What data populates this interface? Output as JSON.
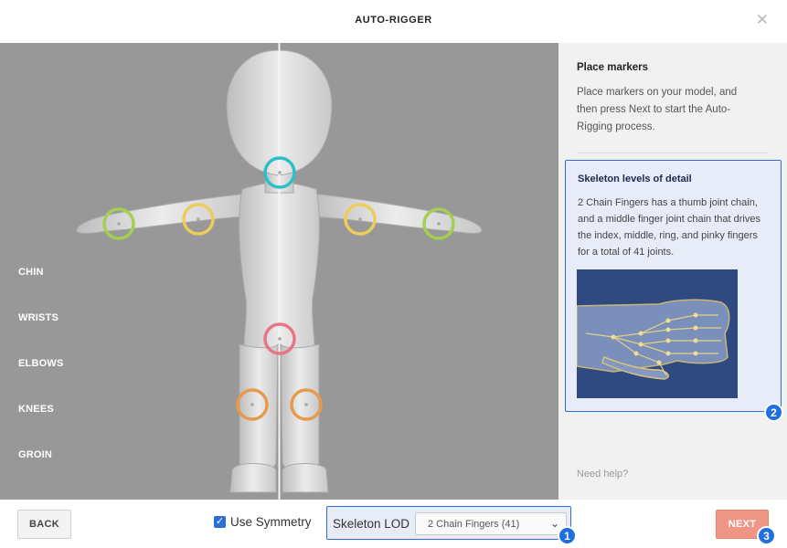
{
  "header": {
    "title": "AUTO-RIGGER",
    "close_glyph": "✕"
  },
  "viewport": {
    "marker_labels": [
      "CHIN",
      "WRISTS",
      "ELBOWS",
      "KNEES",
      "GROIN"
    ],
    "marker_colors": {
      "chin": "#2ac0c8",
      "wrists": "#a4cf52",
      "elbows": "#e9cf5a",
      "knees": "#e89a4c",
      "groin": "#e97485"
    }
  },
  "panel": {
    "heading": "Place markers",
    "description": "Place markers on your model, and then press Next to start the Auto-Rigging process.",
    "lod_card": {
      "heading": "Skeleton levels of detail",
      "description": "2 Chain Fingers has a thumb joint chain, and a middle finger joint chain that drives the index, middle, ring, and pinky fingers for a total of 41 joints."
    },
    "help": "Need help?"
  },
  "footer": {
    "back_label": "BACK",
    "symmetry_label": "Use Symmetry",
    "symmetry_checked": true,
    "lod_label": "Skeleton LOD",
    "lod_selected": "2 Chain Fingers (41)",
    "next_label": "NEXT"
  },
  "badges": [
    "1",
    "2",
    "3"
  ],
  "colors": {
    "accent": "#2b6fd6",
    "next": "#ef9585",
    "viewport": "#989898"
  }
}
